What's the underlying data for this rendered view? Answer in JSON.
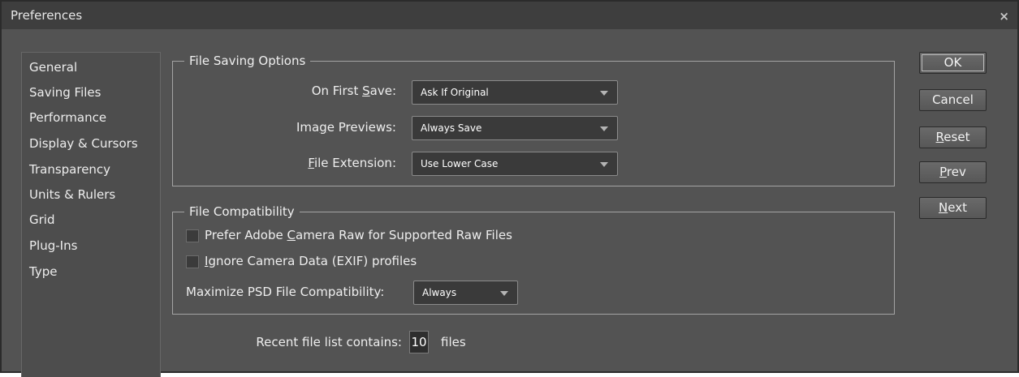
{
  "window": {
    "title": "Preferences",
    "close_glyph": "×"
  },
  "sidebar": {
    "items": [
      {
        "label": "General"
      },
      {
        "label": "Saving Files"
      },
      {
        "label": "Performance"
      },
      {
        "label": "Display & Cursors"
      },
      {
        "label": "Transparency"
      },
      {
        "label": "Units & Rulers"
      },
      {
        "label": "Grid"
      },
      {
        "label": "Plug-Ins"
      },
      {
        "label": "Type"
      }
    ]
  },
  "file_saving": {
    "legend": "File Saving Options",
    "on_first_save": {
      "label_pre": "On First ",
      "label_mnemonic": "S",
      "label_post": "ave:",
      "value": "Ask If Original"
    },
    "image_previews": {
      "label_pre": "Ima",
      "label_mnemonic": "g",
      "label_post": "e Previews:",
      "value": "Always Save"
    },
    "file_extension": {
      "label_pre": "",
      "label_mnemonic": "F",
      "label_post": "ile Extension:",
      "value": "Use Lower Case"
    }
  },
  "file_compat": {
    "legend": "File Compatibility",
    "camera_raw": {
      "pre": "Prefer Adobe ",
      "mnemonic": "C",
      "post": "amera Raw for Supported Raw Files",
      "checked": false
    },
    "ignore_exif": {
      "pre": "",
      "mnemonic": "I",
      "post": "gnore Camera Data (EXIF) profiles",
      "checked": false
    },
    "maximize_psd": {
      "label": "Maximize PSD File Compatibility:",
      "value": "Always"
    }
  },
  "recent": {
    "label": "Recent file list contains:",
    "value": "10",
    "suffix": "files"
  },
  "buttons": {
    "ok": {
      "label": "OK"
    },
    "cancel": {
      "label": "Cancel"
    },
    "reset": {
      "mnemonic": "R",
      "rest": "eset"
    },
    "prev": {
      "mnemonic": "P",
      "rest": "rev"
    },
    "next": {
      "mnemonic": "N",
      "rest": "ext"
    }
  },
  "colors": {
    "panel_bg": "#535353",
    "titlebar_bg": "#3e3e3e",
    "field_bg": "#3a3a3a"
  }
}
